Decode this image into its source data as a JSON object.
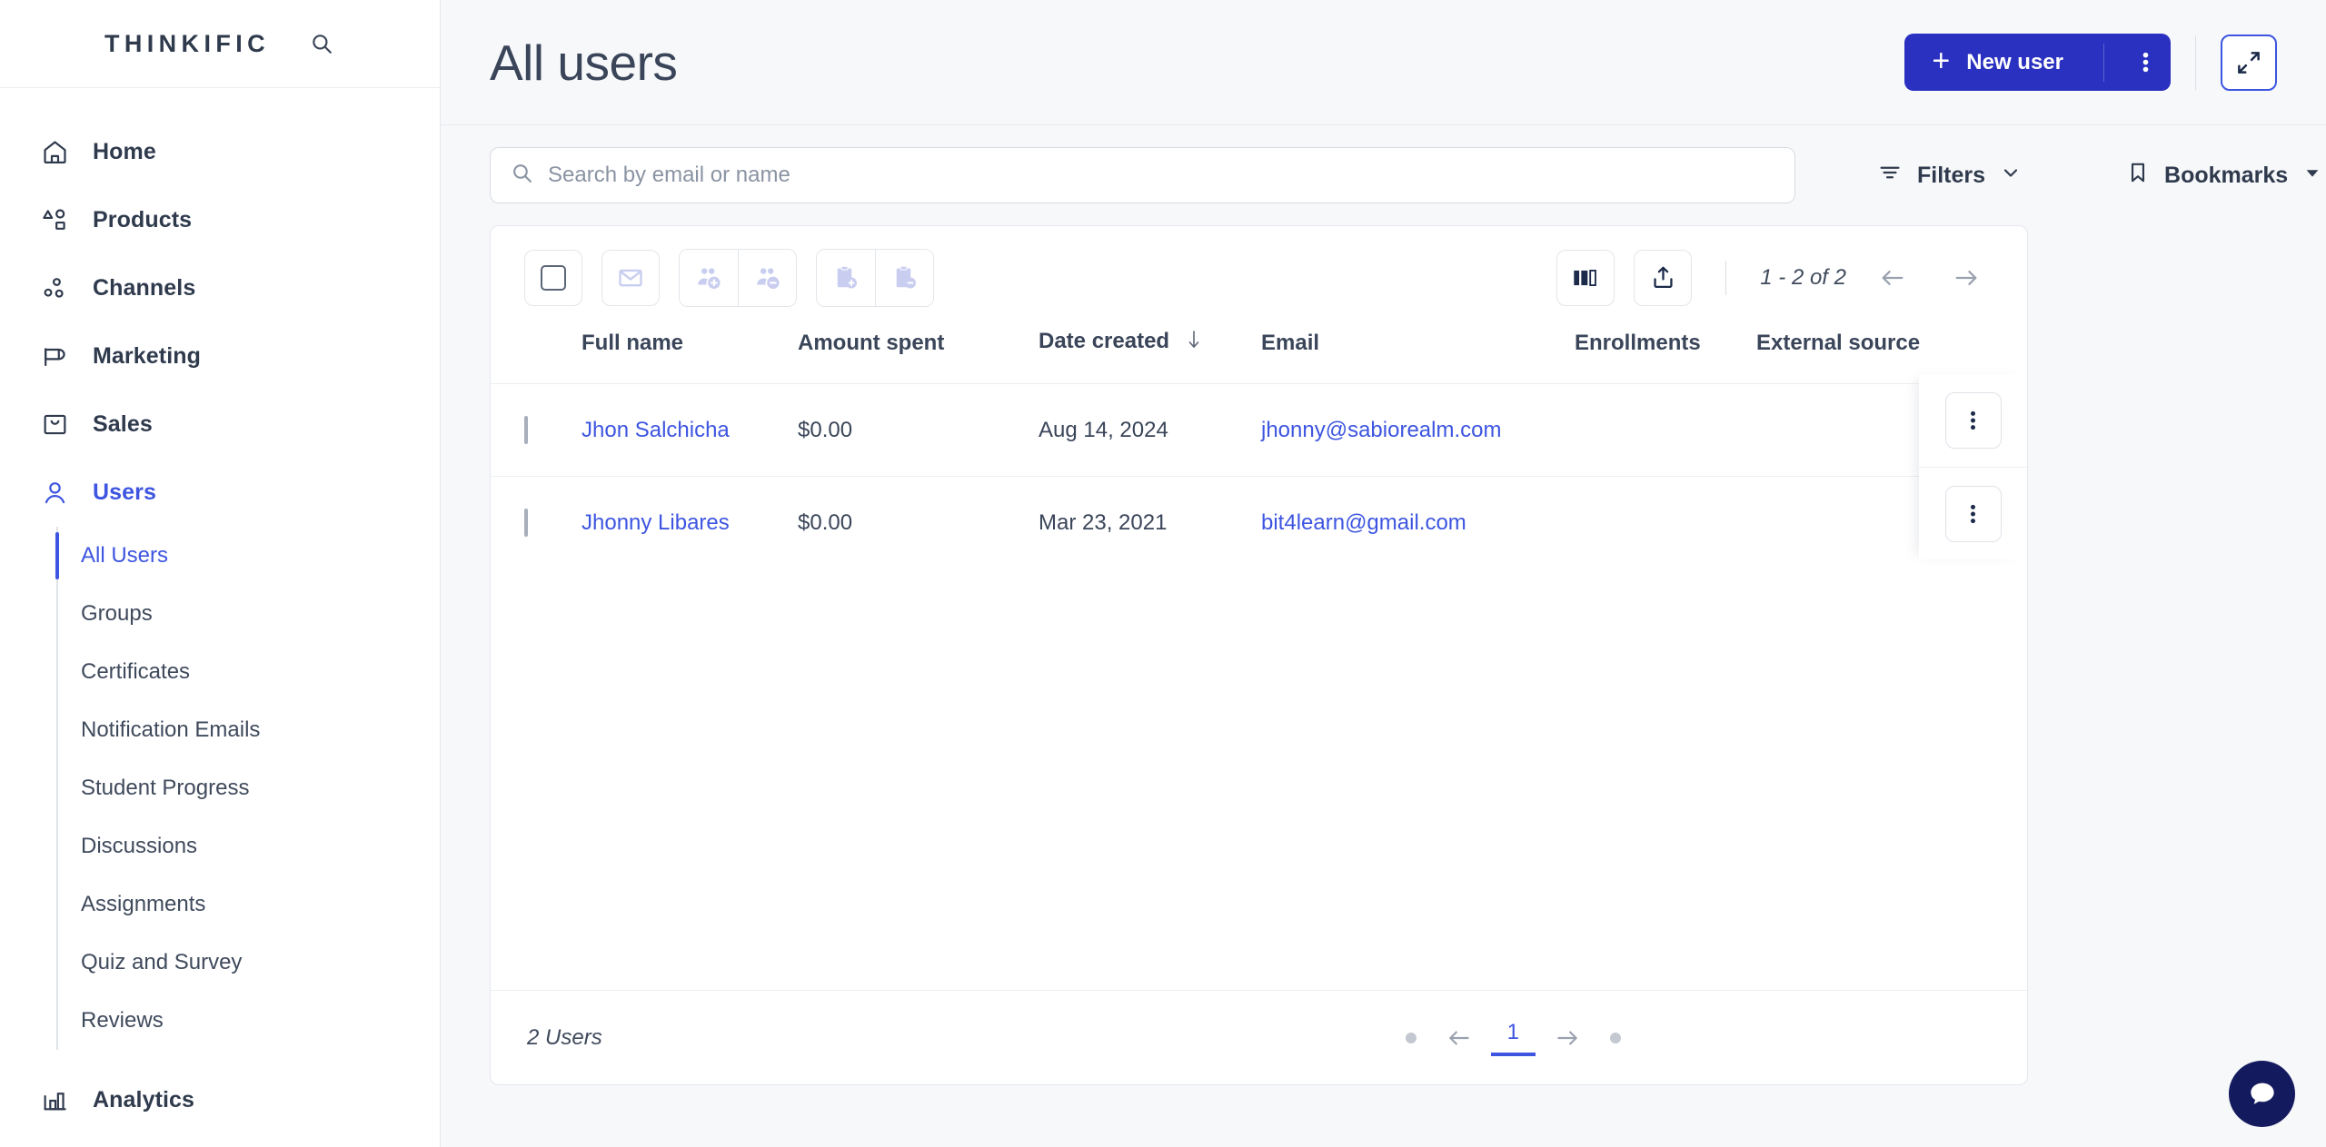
{
  "brand": {
    "logo": "THINKIFIC",
    "accent": "#3d55e0",
    "primary_button": "#2a30bf",
    "chat_bg": "#141a5e"
  },
  "sidebar": {
    "search_icon": "search-icon",
    "items": [
      {
        "label": "Home",
        "icon": "home-icon",
        "active": false
      },
      {
        "label": "Products",
        "icon": "products-icon",
        "active": false
      },
      {
        "label": "Channels",
        "icon": "channels-icon",
        "active": false
      },
      {
        "label": "Marketing",
        "icon": "megaphone-icon",
        "active": false
      },
      {
        "label": "Sales",
        "icon": "bag-icon",
        "active": false
      },
      {
        "label": "Users",
        "icon": "user-icon",
        "active": true
      }
    ],
    "subitems": [
      {
        "label": "All Users",
        "active": true
      },
      {
        "label": "Groups",
        "active": false
      },
      {
        "label": "Certificates",
        "active": false
      },
      {
        "label": "Notification Emails",
        "active": false
      },
      {
        "label": "Student Progress",
        "active": false
      },
      {
        "label": "Discussions",
        "active": false
      },
      {
        "label": "Assignments",
        "active": false
      },
      {
        "label": "Quiz and Survey",
        "active": false
      },
      {
        "label": "Reviews",
        "active": false
      }
    ],
    "analytics": {
      "label": "Analytics",
      "icon": "bar-chart-icon"
    }
  },
  "header": {
    "title": "All users",
    "new_user_label": "New user",
    "new_user_kebab": "kebab-icon",
    "expand_icon": "expand-icon"
  },
  "search": {
    "placeholder": "Search by email or name",
    "value": "",
    "icon": "search-icon"
  },
  "filters": {
    "label": "Filters",
    "icon": "filter-icon",
    "caret": "chevron-down-icon"
  },
  "bookmarks": {
    "label": "Bookmarks",
    "icon": "bookmark-icon",
    "caret": "caret-down-icon"
  },
  "table_toolbar": {
    "select_all": "checkbox-icon",
    "email_action": "envelope-icon",
    "add_to_group": "user-add-icon",
    "remove_from_group": "user-remove-icon",
    "enroll": "clipboard-add-icon",
    "unenroll": "clipboard-remove-icon",
    "columns_icon": "columns-icon",
    "export_icon": "export-icon",
    "range": "1 - 2 of 2",
    "prev_icon": "arrow-left-icon",
    "next_icon": "arrow-right-icon"
  },
  "table": {
    "columns": [
      {
        "key": "name",
        "label": "Full name"
      },
      {
        "key": "amount",
        "label": "Amount spent"
      },
      {
        "key": "date",
        "label": "Date created",
        "sorted": "desc",
        "sort_icon": "arrow-down-icon"
      },
      {
        "key": "email",
        "label": "Email"
      },
      {
        "key": "enrollments",
        "label": "Enrollments"
      },
      {
        "key": "external",
        "label": "External source"
      }
    ],
    "rows": [
      {
        "checked": false,
        "name": "Jhon Salchicha",
        "amount": "$0.00",
        "date": "Aug 14, 2024",
        "email": "jhonny@sabiorealm.com",
        "enrollments": "",
        "external": "",
        "menu_icon": "kebab-icon"
      },
      {
        "checked": false,
        "name": "Jhonny Libares",
        "amount": "$0.00",
        "date": "Mar 23, 2021",
        "email": "bit4learn@gmail.com",
        "enrollments": "",
        "external": "",
        "menu_icon": "kebab-icon"
      }
    ]
  },
  "footer": {
    "count_label": "2 Users",
    "prev_icon": "arrow-left-icon",
    "next_icon": "arrow-right-icon",
    "current_page": "1"
  },
  "chat": {
    "icon": "chat-bubble-icon"
  }
}
